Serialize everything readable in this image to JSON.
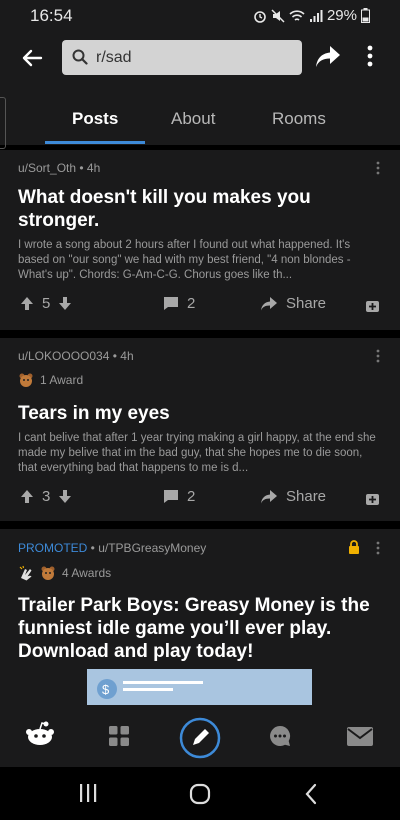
{
  "status_bar": {
    "time": "16:54",
    "battery": "29%"
  },
  "app_bar": {
    "search_query": "r/sad"
  },
  "tabs": [
    {
      "label": "Posts",
      "active": true
    },
    {
      "label": "About",
      "active": false
    },
    {
      "label": "Rooms",
      "active": false
    }
  ],
  "posts": [
    {
      "author": "u/Sort_Oth",
      "age": "4h",
      "title": "What doesn't kill you makes you stronger.",
      "body": "I wrote a song about 2 hours after I found out what happened. It's based on \"our song\" we had with my best friend, \"4 non blondes - What's up\". Chords: G-Am-C-G. Chorus goes like th...",
      "votes": "5",
      "comments": "2",
      "share_label": "Share"
    },
    {
      "author": "u/LOKOOOO034",
      "age": "4h",
      "award_text": "1 Award",
      "title": "Tears in my eyes",
      "body": "I cant belive that after 1 year trying making a girl happy, at the end she made my belive that im the bad guy, that she hopes me to die soon, that everything bad that happens to me is d...",
      "votes": "3",
      "comments": "2",
      "share_label": "Share"
    },
    {
      "promoted_label": "PROMOTED",
      "author": "u/TPBGreasyMoney",
      "award_text": "4 Awards",
      "title": "Trailer Park Boys: Greasy Money is the funniest idle game you’ll ever play. Download and play today!"
    }
  ],
  "colors": {
    "accent": "#3d8ad8",
    "card": "#1a1a1b",
    "background": "#000000",
    "text": "#d7dadc",
    "meta": "#9a9a9a"
  }
}
